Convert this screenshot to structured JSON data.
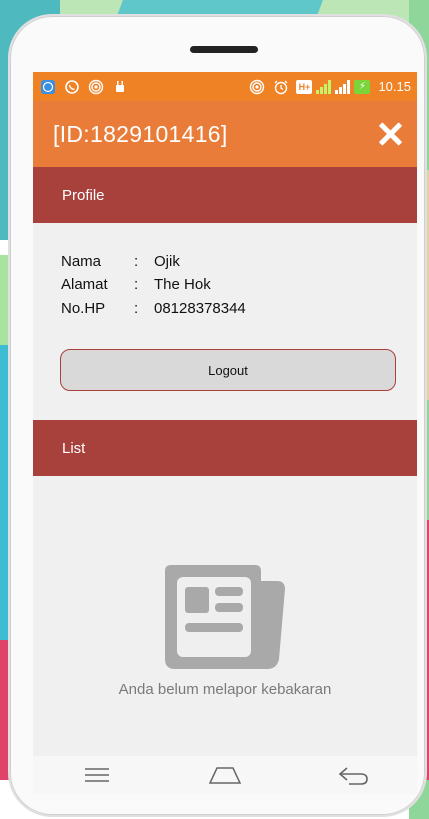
{
  "status_bar": {
    "left_icons": [
      "messenger-icon",
      "whatsapp-icon",
      "hotspot-icon",
      "android-icon"
    ],
    "right_icons": [
      "hotspot-icon",
      "alarm-icon",
      "hplus-icon",
      "signal-icon",
      "signal-2-icon",
      "battery-charging-icon"
    ],
    "hplus_label": "H+",
    "time": "10.15"
  },
  "app_bar": {
    "title": "[ID:1829101416]",
    "close_icon": "close-icon",
    "color": "#ea7c3a"
  },
  "profile": {
    "header": "Profile",
    "fields": [
      {
        "label": "Nama",
        "value": "Ojik"
      },
      {
        "label": "Alamat",
        "value": "The Hok"
      },
      {
        "label": "No.HP",
        "value": "08128378344"
      }
    ],
    "separator": ":",
    "logout_label": "Logout"
  },
  "list": {
    "header": "List",
    "empty_icon": "newspaper-icon",
    "empty_message": "Anda belum melapor kebakaran"
  },
  "nav_bar": {
    "buttons": [
      "menu-icon",
      "home-icon",
      "back-icon"
    ]
  },
  "colors": {
    "status_bar": "#f08226",
    "section_header": "#a8403b",
    "background": "#efefef"
  }
}
